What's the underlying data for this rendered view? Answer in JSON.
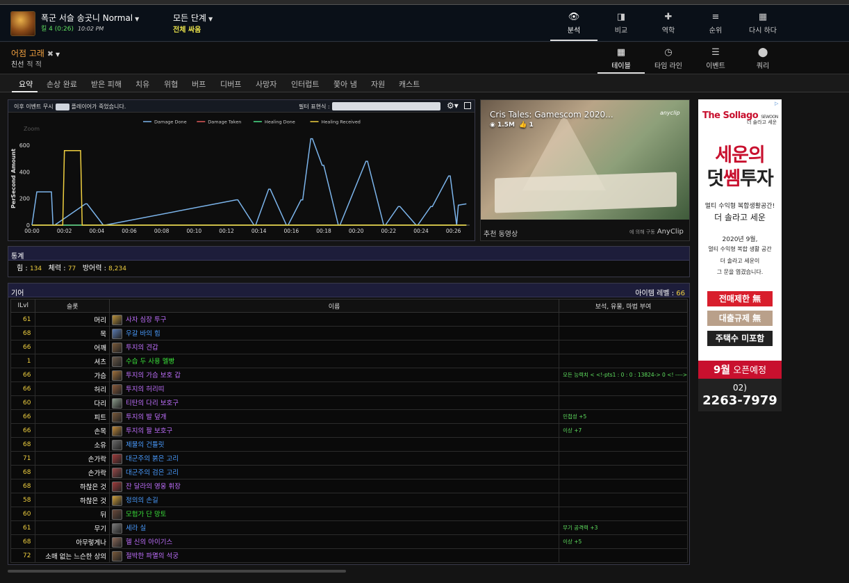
{
  "header": {
    "fight_title": "폭군 서슬 송곳니 Normal",
    "kill_text": "킬 4 (0:26)",
    "time_text": "10:02 PM",
    "phase_title": "모든 단계",
    "phase_sub": "전체 싸움",
    "tabs": [
      {
        "label": "분석",
        "icon": "eye-icon",
        "active": true
      },
      {
        "label": "비교",
        "icon": "compare-icon"
      },
      {
        "label": "역학",
        "icon": "puzzle-icon"
      },
      {
        "label": "순위",
        "icon": "rankings-icon"
      },
      {
        "label": "다시 하다",
        "icon": "replay-icon"
      }
    ]
  },
  "player": {
    "name": "어점 고래",
    "close": "✖",
    "friendly": "친선",
    "foe": "적 적",
    "views": [
      {
        "label": "테이블",
        "icon": "grid-icon",
        "active": true
      },
      {
        "label": "타임 라인",
        "icon": "clock-icon"
      },
      {
        "label": "이벤트",
        "icon": "list-icon"
      },
      {
        "label": "쿼리",
        "icon": "map-pin-icon"
      }
    ]
  },
  "subtabs": [
    "요약",
    "손상 완료",
    "받은 피해",
    "치유",
    "위협",
    "버프",
    "디버프",
    "사망자",
    "인터럽트",
    "쫓아 냄",
    "자원",
    "캐스트"
  ],
  "chart_toolbar": {
    "left_a": "이후 이벤트 무시",
    "left_b": "플레이어가 죽었습니다.",
    "filter_label": "필터 표현식 :"
  },
  "chart_data": {
    "type": "line",
    "ylabel": "PerSecond Amount",
    "zoom_label": "Zoom",
    "ylim": [
      0,
      700
    ],
    "yticks": [
      0,
      200,
      400,
      600
    ],
    "xticks": [
      "00:00",
      "00:02",
      "00:04",
      "00:06",
      "00:08",
      "00:10",
      "00:12",
      "00:14",
      "00:16",
      "00:18",
      "00:20",
      "00:22",
      "00:24",
      "00:26"
    ],
    "xlim": [
      0,
      27
    ],
    "grid": false,
    "legend_position": "top",
    "series": [
      {
        "name": "Damage Done",
        "color": "#7cb5ec",
        "x": [
          0,
          0.3,
          1.2,
          1.3,
          1.4,
          3.3,
          3.4,
          4.4,
          4.5,
          12.6,
          12.7,
          13.7,
          13.8,
          14.6,
          14.7,
          15.7,
          15.8,
          16.6,
          16.7,
          17.2,
          17.3,
          17.9,
          18.0,
          18.9,
          19.0,
          20.6,
          20.7,
          21.7,
          21.8,
          22.6,
          22.7,
          23.7,
          23.8,
          24.6,
          24.7,
          25.7,
          25.8,
          26.2,
          26.3,
          26.8
        ],
        "y": [
          0,
          250,
          250,
          0,
          0,
          160,
          160,
          0,
          0,
          190,
          190,
          0,
          0,
          270,
          270,
          0,
          0,
          190,
          190,
          650,
          650,
          450,
          450,
          0,
          0,
          480,
          480,
          0,
          0,
          140,
          140,
          0,
          0,
          140,
          140,
          370,
          370,
          0,
          150,
          160
        ]
      },
      {
        "name": "Damage Taken",
        "color": "#e05a5a",
        "x": [
          0,
          26.8
        ],
        "y": [
          0,
          0
        ]
      },
      {
        "name": "Healing Done",
        "color": "#4ae08a",
        "x": [
          0,
          26.8
        ],
        "y": [
          0,
          0
        ]
      },
      {
        "name": "Healing Received",
        "color": "#f0d040",
        "x": [
          0,
          1.9,
          2.0,
          3.0,
          3.1,
          26.8
        ],
        "y": [
          0,
          0,
          560,
          560,
          0,
          0
        ]
      }
    ]
  },
  "video": {
    "title": "Cris Tales: Gamescom 2020...",
    "views": "1.5M",
    "likes": "1",
    "logo": "anyclip",
    "caption": "추천 동영상",
    "by_prefix": "에 의해 구동",
    "by": "AnyClip"
  },
  "ad": {
    "brand": "The Sollago",
    "brand_sub": "SEWOON",
    "brand_small": "더 솔라고 세운",
    "line1": "세운의",
    "line2a": "덧",
    "line2b": "쎔",
    "line2c": "투자",
    "desc1": "멀티 수익형 복합생활공간!",
    "desc2": "더 솔라고 세운",
    "p1": "2020년 9월,",
    "p2": "멀티 수익형 복합 생활 공간",
    "p3": "더 솔라고 세운이",
    "p4": "그 문을 엽겼습니다.",
    "btn1": "전매제한 無",
    "btn2": "대출규제 無",
    "btn3": "주택수 미포함",
    "foot_a": "9월",
    "foot_b": " 오픈예정",
    "phone_a": "02)",
    "phone_b": "2263-7979"
  },
  "stats": {
    "title": "통계",
    "str_label": "힘 :",
    "str": "134",
    "sta_label": "체력 :",
    "sta": "77",
    "armor_label": "방어력 :",
    "armor": "8,234"
  },
  "gear": {
    "title": "기어",
    "ilvl_label": "아이템 레벨 :",
    "ilvl": "66",
    "columns": [
      "ILvl",
      "슬롯",
      "이름",
      "보석, 유물, 마법 부여"
    ],
    "rows": [
      {
        "ilvl": "61",
        "slot": "머리",
        "name": "사자 심장 투구",
        "q": "epic",
        "ic": "#b8903a",
        "ench": ""
      },
      {
        "ilvl": "68",
        "slot": "목",
        "name": "우갈 바의 힘",
        "q": "rare",
        "ic": "#5a7ab0",
        "ench": ""
      },
      {
        "ilvl": "66",
        "slot": "어깨",
        "name": "투지의 견갑",
        "q": "epic",
        "ic": "#7a5a3a",
        "ench": ""
      },
      {
        "ilvl": "1",
        "slot": "셔츠",
        "name": "수습 두 사용 멜빵",
        "q": "unc",
        "ic": "#6a5a4a",
        "ench": ""
      },
      {
        "ilvl": "66",
        "slot": "가슴",
        "name": "투지의 가슴 보호 갑",
        "q": "epic",
        "ic": "#a0703a",
        "ench": "모든 능력치 < <!-pts1 : 0 : 0 : 13824-> 0 <! ---->"
      },
      {
        "ilvl": "66",
        "slot": "허리",
        "name": "투지의 허리띠",
        "q": "epic",
        "ic": "#8a5a3a",
        "ench": ""
      },
      {
        "ilvl": "60",
        "slot": "다리",
        "name": "티탄의 다리 보호구",
        "q": "epic",
        "ic": "#8a9a8a",
        "ench": ""
      },
      {
        "ilvl": "66",
        "slot": "피트",
        "name": "투지의 발 덮개",
        "q": "epic",
        "ic": "#7a5a3a",
        "ench": "민첩성 +5"
      },
      {
        "ilvl": "66",
        "slot": "손목",
        "name": "투지의 팔 보호구",
        "q": "epic",
        "ic": "#c08a3a",
        "ench": "이상 +7"
      },
      {
        "ilvl": "68",
        "slot": "소유",
        "name": "제물의 건틀릿",
        "q": "rare",
        "ic": "#6a6a6a",
        "ench": ""
      },
      {
        "ilvl": "71",
        "slot": "손가락",
        "name": "대군주의 붉은 고리",
        "q": "rare",
        "ic": "#a03a3a",
        "ench": ""
      },
      {
        "ilvl": "68",
        "slot": "손가락",
        "name": "대군주의 검은 고리",
        "q": "rare",
        "ic": "#9a4a4a",
        "ench": ""
      },
      {
        "ilvl": "68",
        "slot": "하찮은 것",
        "name": "잔 달라의 영웅 휘장",
        "q": "epic",
        "ic": "#a03a3a",
        "ench": ""
      },
      {
        "ilvl": "58",
        "slot": "하찮은 것",
        "name": "정의의 손길",
        "q": "rare",
        "ic": "#d0a03a",
        "ench": ""
      },
      {
        "ilvl": "60",
        "slot": "뒤",
        "name": "모험가 단 망토",
        "q": "unc",
        "ic": "#6a4a3a",
        "ench": ""
      },
      {
        "ilvl": "61",
        "slot": "무기",
        "name": "세라 실",
        "q": "rare",
        "ic": "#7a7a7a",
        "ench": "무기 공격력 +3"
      },
      {
        "ilvl": "68",
        "slot": "아무렇게나",
        "name": "헬 신의 아이기스",
        "q": "epic",
        "ic": "#8a6a5a",
        "ench": "이상 +5"
      },
      {
        "ilvl": "72",
        "slot": "소매 없는 느슨한 상의",
        "name": "절박한 파멸의 석궁",
        "q": "epic",
        "ic": "#7a5a3a",
        "ench": ""
      }
    ]
  }
}
